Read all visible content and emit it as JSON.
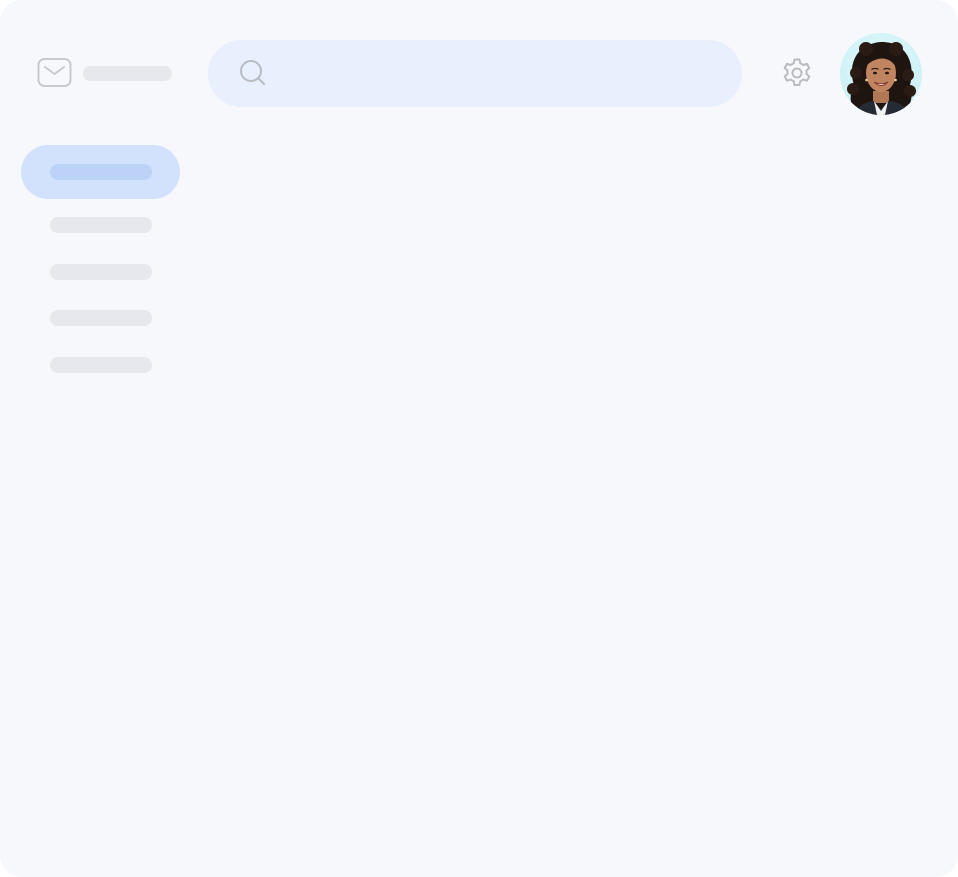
{
  "app": {
    "logo_icon": "mail-icon"
  },
  "search": {
    "icon": "search-icon",
    "value": "",
    "placeholder": ""
  },
  "header": {
    "settings_icon": "gear-icon",
    "avatar": "user-avatar-photo"
  },
  "sidebar": {
    "items": [
      {
        "state": "active"
      },
      {
        "state": "inactive"
      },
      {
        "state": "inactive"
      },
      {
        "state": "inactive"
      },
      {
        "state": "inactive"
      }
    ]
  },
  "colors": {
    "background": "#f7f8fc",
    "search_bg": "#e8effd",
    "nav_active_bg": "#d2e2fc",
    "nav_active_skeleton": "#bcd3f7",
    "skeleton": "#e6e8ed",
    "icon_gray": "#b8bcc2"
  }
}
